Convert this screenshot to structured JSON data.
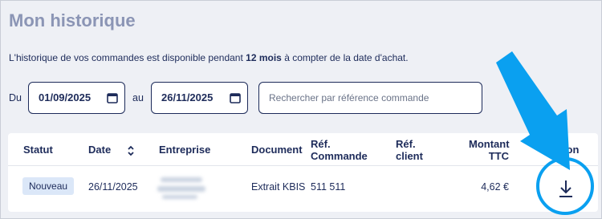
{
  "header": {
    "title": "Mon historique",
    "intro_before": "L'historique de vos commandes est disponible pendant ",
    "intro_bold": "12 mois",
    "intro_after": " à compter de la date d'achat."
  },
  "filters": {
    "from_label": "Du",
    "from_value": "01/09/2025",
    "to_label": "au",
    "to_value": "26/11/2025",
    "search_placeholder": "Rechercher par référence commande"
  },
  "table": {
    "columns": {
      "statut": "Statut",
      "date": "Date",
      "entreprise": "Entreprise",
      "document": "Document",
      "ref_commande_1": "Réf.",
      "ref_commande_2": "Commande",
      "ref_client_1": "Réf.",
      "ref_client_2": "client",
      "montant_1": "Montant",
      "montant_2": "TTC",
      "action": "Action"
    },
    "rows": [
      {
        "statut": "Nouveau",
        "date": "26/11/2025",
        "document": "Extrait KBIS",
        "ref_commande": "511 511",
        "montant": "4,62 €"
      }
    ]
  },
  "colors": {
    "title": "#8b95b5",
    "text": "#1d2b5a",
    "badge_bg": "#dbe7f8",
    "annotation": "#0aa0f0"
  },
  "icons": [
    "calendar-icon",
    "sort-icon",
    "download-icon"
  ]
}
